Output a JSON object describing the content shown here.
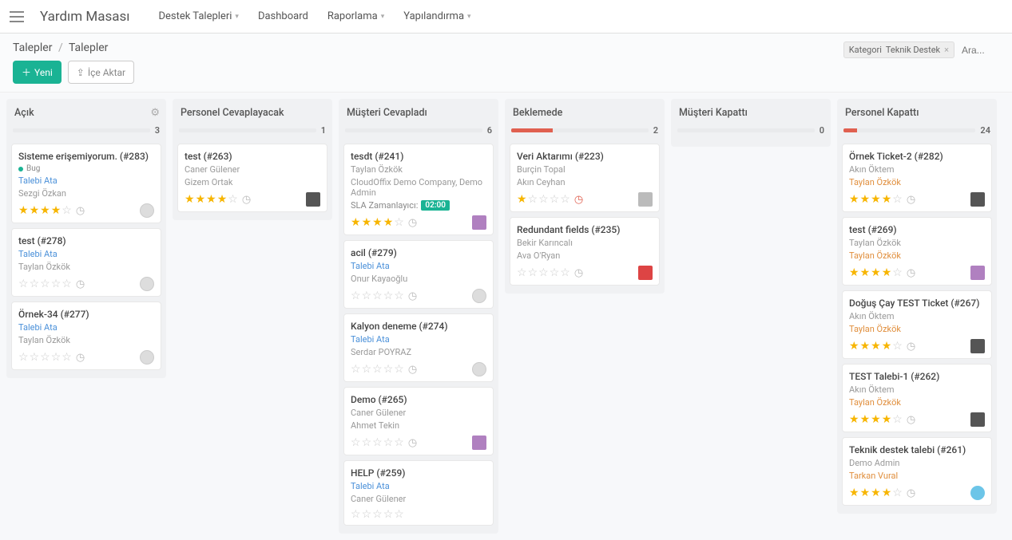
{
  "header": {
    "brand": "Yardım Masası",
    "nav": [
      {
        "label": "Destek Talepleri",
        "dropdown": true
      },
      {
        "label": "Dashboard",
        "dropdown": false
      },
      {
        "label": "Raporlama",
        "dropdown": true
      },
      {
        "label": "Yapılandırma",
        "dropdown": true
      }
    ]
  },
  "breadcrumb": {
    "root": "Talepler",
    "current": "Talepler"
  },
  "buttons": {
    "new": "Yeni",
    "import": "İçe Aktar"
  },
  "filter": {
    "cat_label": "Kategori",
    "cat_value": "Teknik Destek",
    "search_placeholder": "Ara..."
  },
  "columns": [
    {
      "title": "Açık",
      "count": "3",
      "bar_pct": 0,
      "gear": true,
      "cards": [
        {
          "title": "Sisteme erişemiyorum. (#283)",
          "tags": [
            "Bug"
          ],
          "meta1": {
            "text": "Talebi Ata",
            "cls": "meta-link"
          },
          "meta2": {
            "text": "Sezgi Özkan",
            "cls": "meta-grey"
          },
          "stars": 4,
          "clock": true,
          "avatar": "circ"
        },
        {
          "title": "test (#278)",
          "meta1": {
            "text": "Talebi Ata",
            "cls": "meta-link"
          },
          "meta2": {
            "text": "Taylan Özkök",
            "cls": "meta-grey"
          },
          "stars": 0,
          "clock": true,
          "avatar": "circ"
        },
        {
          "title": "Örnek-34 (#277)",
          "meta1": {
            "text": "Talebi Ata",
            "cls": "meta-link"
          },
          "meta2": {
            "text": "Taylan Özkök",
            "cls": "meta-grey"
          },
          "stars": 0,
          "clock": true,
          "avatar": "circ"
        }
      ]
    },
    {
      "title": "Personel Cevaplayacak",
      "count": "1",
      "bar_pct": 0,
      "cards": [
        {
          "title": "test (#263)",
          "meta1": {
            "text": "Caner Gülener",
            "cls": "meta-grey"
          },
          "meta2": {
            "text": "Gizem Ortak",
            "cls": "meta-grey"
          },
          "stars": 4,
          "clock": true,
          "avatar": "dark"
        }
      ]
    },
    {
      "title": "Müşteri Cevapladı",
      "count": "6",
      "bar_pct": 0,
      "cards": [
        {
          "title": "tesdt (#241)",
          "meta1": {
            "text": "Taylan Özkök",
            "cls": "meta-grey"
          },
          "meta2": {
            "text": "CloudOffix Demo Company, Demo Admin",
            "cls": "meta-grey"
          },
          "sla_label": "SLA Zamanlayıcı:",
          "sla_time": "02:00",
          "stars": 4,
          "clock": true,
          "avatar": ""
        },
        {
          "title": "acil (#279)",
          "meta1": {
            "text": "Talebi Ata",
            "cls": "meta-link"
          },
          "meta2": {
            "text": "Onur Kayaoğlu",
            "cls": "meta-grey"
          },
          "stars": 0,
          "clock": true,
          "avatar": "circ"
        },
        {
          "title": "Kalyon deneme (#274)",
          "meta1": {
            "text": "Talebi Ata",
            "cls": "meta-link"
          },
          "meta2": {
            "text": "Serdar POYRAZ",
            "cls": "meta-grey"
          },
          "stars": 0,
          "clock": true,
          "avatar": "circ"
        },
        {
          "title": "Demo (#265)",
          "meta1": {
            "text": "Caner Gülener",
            "cls": "meta-grey"
          },
          "meta2": {
            "text": "Ahmet Tekin",
            "cls": "meta-grey"
          },
          "stars": 0,
          "clock": true,
          "avatar": ""
        },
        {
          "title": "HELP (#259)",
          "meta1": {
            "text": "Talebi Ata",
            "cls": "meta-link"
          },
          "meta2": {
            "text": "Caner Gülener",
            "cls": "meta-grey"
          },
          "stars": 0
        }
      ]
    },
    {
      "title": "Beklemede",
      "count": "2",
      "bar_pct": 30,
      "cards": [
        {
          "title": "Veri Aktarımı (#223)",
          "meta1": {
            "text": "Burçin Topal",
            "cls": "meta-grey"
          },
          "meta2": {
            "text": "Akın Ceyhan",
            "cls": "meta-grey"
          },
          "stars": 1,
          "clock": true,
          "clock_red": true,
          "avatar": "grey"
        },
        {
          "title": "Redundant fields (#235)",
          "meta1": {
            "text": "Bekir Karıncalı",
            "cls": "meta-grey"
          },
          "meta2": {
            "text": "Ava O'Ryan",
            "cls": "meta-grey"
          },
          "stars": 0,
          "clock": true,
          "avatar": "red"
        }
      ]
    },
    {
      "title": "Müşteri Kapattı",
      "count": "0",
      "bar_pct": 0,
      "cards": []
    },
    {
      "title": "Personel Kapattı",
      "count": "24",
      "bar_pct": 10,
      "cards": [
        {
          "title": "Örnek Ticket-2 (#282)",
          "meta1": {
            "text": "Akın Öktem",
            "cls": "meta-grey"
          },
          "meta2": {
            "text": "Taylan Özkök",
            "cls": "meta-orange"
          },
          "stars": 4,
          "clock": true,
          "avatar": "dark"
        },
        {
          "title": "test (#269)",
          "meta1": {
            "text": "Taylan Özkök",
            "cls": "meta-grey"
          },
          "meta2": {
            "text": "Taylan Özkök",
            "cls": "meta-orange"
          },
          "stars": 4,
          "clock": true,
          "avatar": ""
        },
        {
          "title": "Doğuş Çay TEST Ticket (#267)",
          "meta1": {
            "text": "Akın Öktem",
            "cls": "meta-grey"
          },
          "meta2": {
            "text": "Taylan Özkök",
            "cls": "meta-orange"
          },
          "stars": 4,
          "clock": true,
          "avatar": "dark"
        },
        {
          "title": "TEST Talebi-1 (#262)",
          "meta1": {
            "text": "Akın Öktem",
            "cls": "meta-grey"
          },
          "meta2": {
            "text": "Taylan Özkök",
            "cls": "meta-orange"
          },
          "stars": 4,
          "clock": true,
          "avatar": "dark"
        },
        {
          "title": "Teknik destek talebi (#261)",
          "meta1": {
            "text": "Demo Admin",
            "cls": "meta-grey"
          },
          "meta2": {
            "text": "Tarkan Vural",
            "cls": "meta-orange"
          },
          "stars": 4,
          "clock": true,
          "avatar": "blue"
        }
      ]
    }
  ]
}
